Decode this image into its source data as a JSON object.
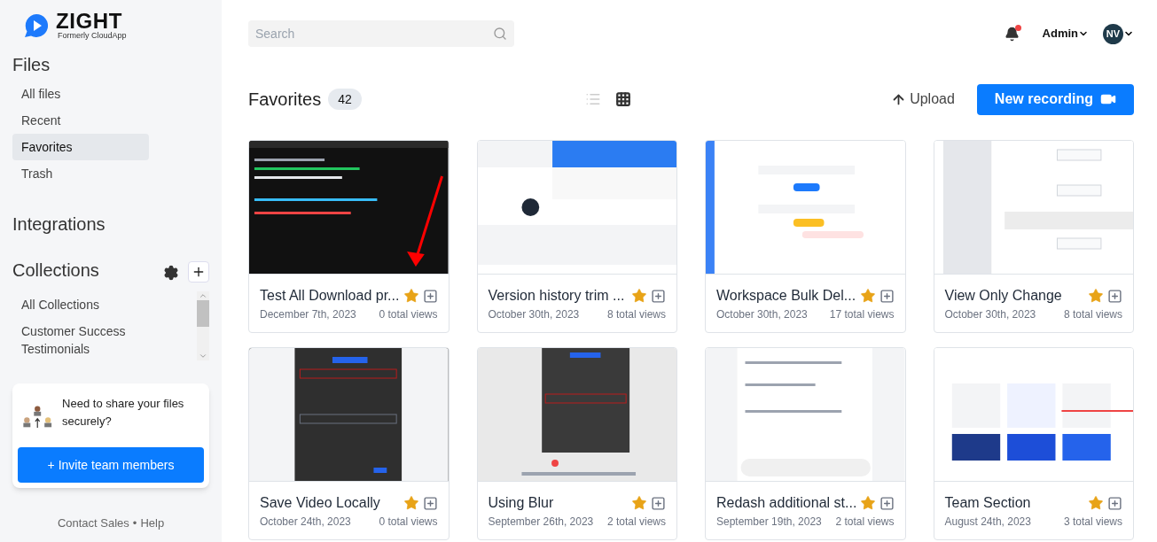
{
  "brand": {
    "name": "ZIGHT",
    "tagline": "Formerly CloudApp"
  },
  "sidebar": {
    "files_heading": "Files",
    "items": [
      {
        "label": "All files",
        "selected": false
      },
      {
        "label": "Recent",
        "selected": false
      },
      {
        "label": "Favorites",
        "selected": true
      },
      {
        "label": "Trash",
        "selected": false
      }
    ],
    "integrations_heading": "Integrations",
    "collections_heading": "Collections",
    "collections": [
      {
        "label": "All Collections"
      },
      {
        "label": "Customer Success Testimonials"
      }
    ],
    "invite_card": {
      "text": "Need to share your files securely?",
      "button": "+ Invite team members"
    },
    "footer": {
      "contact": "Contact Sales",
      "separator": "•",
      "help": "Help"
    }
  },
  "topbar": {
    "search": {
      "placeholder": "Search"
    },
    "notifications": {
      "unread": true
    },
    "account_menu": "Admin",
    "avatar_initials": "NV"
  },
  "page": {
    "title": "Favorites",
    "count": "42",
    "view_modes": [
      {
        "kind": "list",
        "selected": false
      },
      {
        "kind": "grid",
        "selected": true
      }
    ],
    "upload": "Upload",
    "new_recording": "New recording"
  },
  "files": [
    {
      "title": "Test All Download pr...",
      "date": "December 7th, 2023",
      "views": "0 total views",
      "starred": true
    },
    {
      "title": "Version history trim ...",
      "date": "October 30th, 2023",
      "views": "8 total views",
      "starred": true
    },
    {
      "title": "Workspace Bulk Del...",
      "date": "October 30th, 2023",
      "views": "17 total views",
      "starred": true
    },
    {
      "title": "View Only Change",
      "date": "October 30th, 2023",
      "views": "8 total views",
      "starred": true
    },
    {
      "title": "Save Video Locally",
      "date": "October 24th, 2023",
      "views": "0 total views",
      "starred": true
    },
    {
      "title": "Using Blur",
      "date": "September 26th, 2023",
      "views": "2 total views",
      "starred": true
    },
    {
      "title": "Redash additional st...",
      "date": "September 19th, 2023",
      "views": "2 total views",
      "starred": true
    },
    {
      "title": "Team Section",
      "date": "August 24th, 2023",
      "views": "3 total views",
      "starred": true
    }
  ]
}
